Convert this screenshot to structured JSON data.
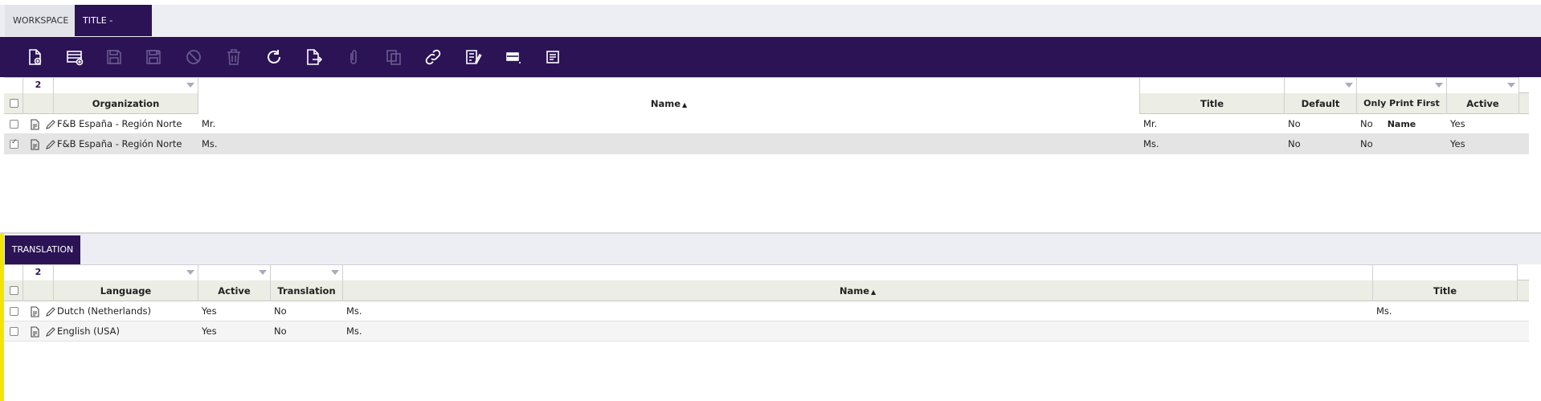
{
  "tabs": {
    "workspace": "WORKSPACE",
    "active": "TITLE - MS.",
    "close_glyph": "×"
  },
  "toolbar": {
    "icons": [
      "new-document-icon",
      "new-record-icon",
      "save-icon",
      "save-close-icon",
      "cancel-icon",
      "delete-icon",
      "refresh-icon",
      "export-icon",
      "attachment-icon",
      "clone-icon",
      "link-icon",
      "audit-icon",
      "form-view-icon",
      "notes-icon"
    ]
  },
  "upper": {
    "count": "2",
    "headers": {
      "organization": "Organization",
      "name": "Name",
      "title": "Title",
      "default": "Default",
      "only_print_first_name": "Only Print First Name",
      "active": "Active"
    },
    "sort_glyph": "▲",
    "rows": [
      {
        "organization": "F&B España - Región Norte",
        "name": "Mr.",
        "title": "Mr.",
        "default": "No",
        "only_print_first_name": "No",
        "active": "Yes",
        "selected": false
      },
      {
        "organization": "F&B España - Región Norte",
        "name": "Ms.",
        "title": "Ms.",
        "default": "No",
        "only_print_first_name": "No",
        "active": "Yes",
        "selected": true
      }
    ]
  },
  "lower": {
    "tab_label": "TRANSLATION",
    "count": "2",
    "headers": {
      "language": "Language",
      "active": "Active",
      "translation": "Translation",
      "name": "Name",
      "title": "Title"
    },
    "sort_glyph": "▲",
    "rows": [
      {
        "language": "Dutch (Netherlands)",
        "active": "Yes",
        "translation": "No",
        "name": "Ms.",
        "title": "Ms."
      },
      {
        "language": "English (USA)",
        "active": "Yes",
        "translation": "No",
        "name": "Ms.",
        "title": ""
      }
    ]
  },
  "colors": {
    "brand": "#2b1356",
    "header_bg": "#ecede4",
    "selected_row": "#e4e4e4",
    "accent_yellow": "#f2e600"
  }
}
